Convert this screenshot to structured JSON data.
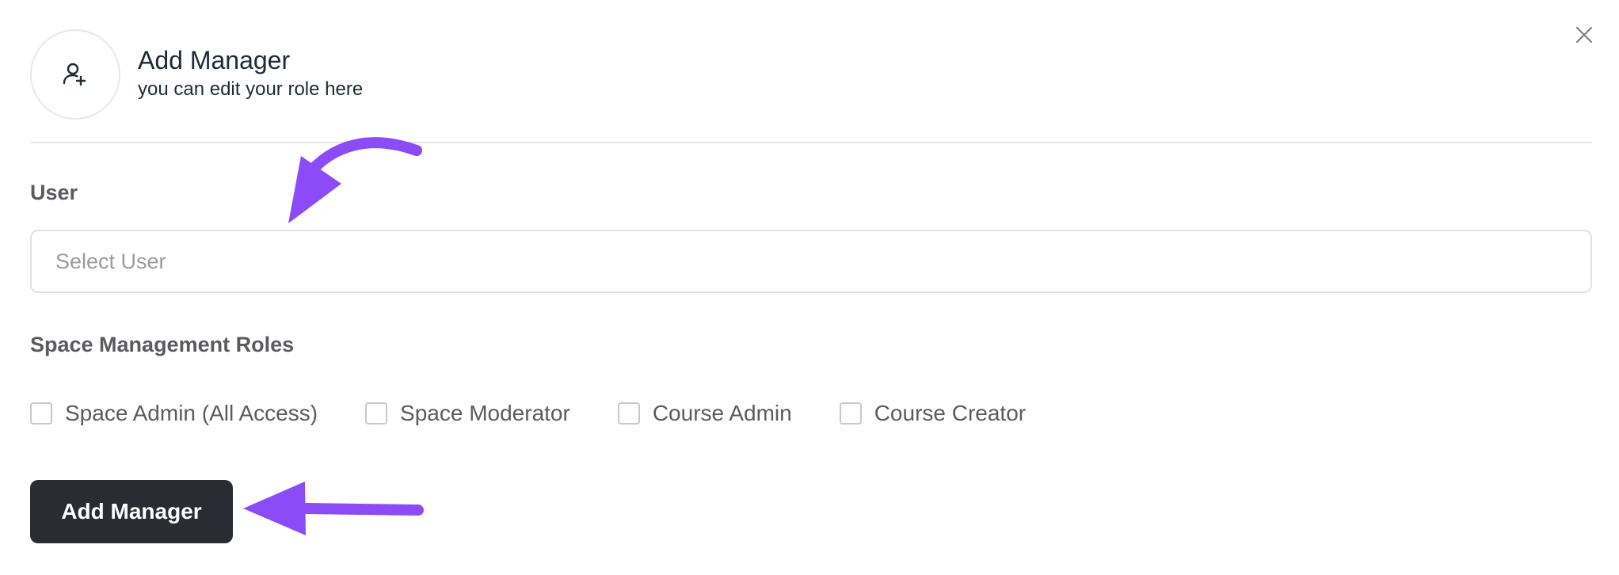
{
  "header": {
    "title": "Add Manager",
    "subtitle": "you can edit your role here",
    "icon": "user-plus-icon"
  },
  "close": {
    "icon": "close-icon"
  },
  "user_field": {
    "label": "User",
    "placeholder": "Select User",
    "value": ""
  },
  "roles": {
    "label": "Space Management Roles",
    "options": [
      {
        "label": "Space Admin (All Access)",
        "checked": false
      },
      {
        "label": "Space Moderator",
        "checked": false
      },
      {
        "label": "Course Admin",
        "checked": false
      },
      {
        "label": "Course Creator",
        "checked": false
      }
    ]
  },
  "submit": {
    "label": "Add Manager"
  },
  "colors": {
    "primary_button_bg": "#2b2c33",
    "annotation_arrow": "#8b4cf7",
    "label_text": "#5b5b5f",
    "placeholder_text": "#9b9ba0"
  }
}
